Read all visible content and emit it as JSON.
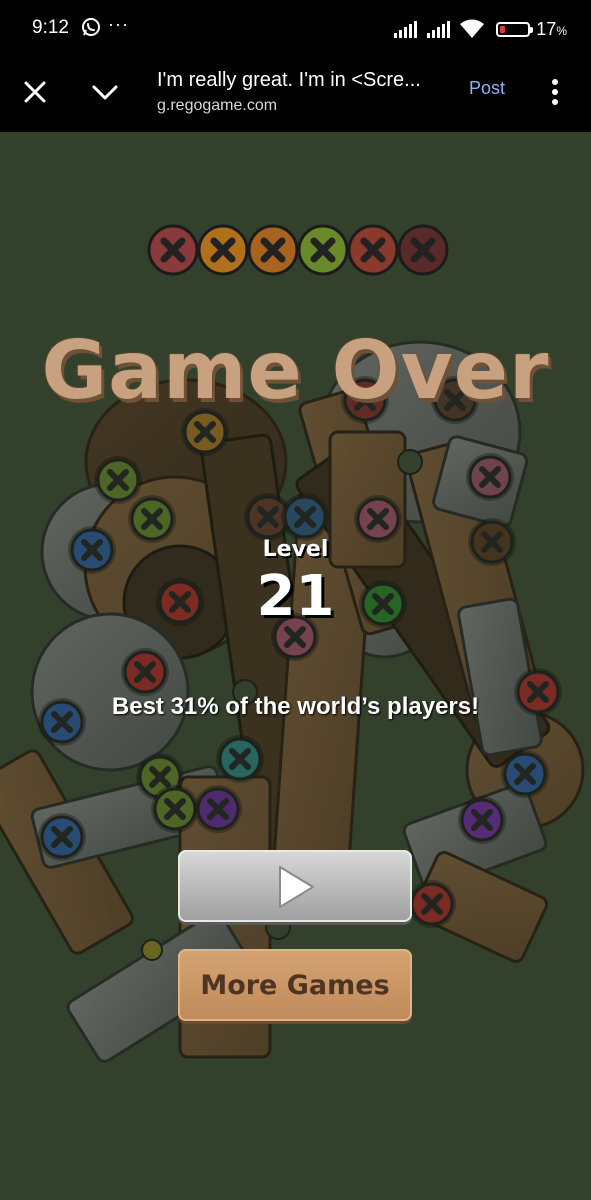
{
  "status_bar": {
    "time": "9:12",
    "more_dots": "···",
    "battery_percent": "17",
    "battery_unit": "%",
    "battery_level": 0.17,
    "battery_color": "#e53935"
  },
  "browser": {
    "page_title": "I'm really great. I'm in <Scre...",
    "page_url": "g.regogame.com",
    "post_label": "Post"
  },
  "game": {
    "title": "Game Over",
    "level_label": "Level",
    "level_number": "21",
    "rank_text": "Best 31% of the world’s players!",
    "more_games_label": "More Games",
    "collected_screw_colors": [
      "#8a3a3a",
      "#b0701c",
      "#a8641e",
      "#6a8a2a",
      "#8a3a2a",
      "#5a2a2a"
    ]
  },
  "icons": {
    "status": [
      "whatsapp-icon",
      "signal-icon",
      "wifi-icon",
      "battery-icon"
    ],
    "browser": [
      "close-icon",
      "chevron-down-icon",
      "more-vert-icon"
    ],
    "game": [
      "play-icon",
      "screw-icon"
    ]
  }
}
